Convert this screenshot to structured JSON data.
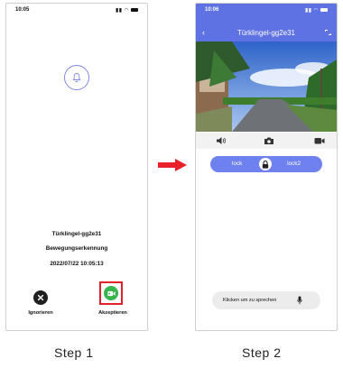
{
  "step1": {
    "status_time": "10:05",
    "device_name": "Türklingel-gg2e31",
    "event_type": "Bewegungserkennung",
    "timestamp": "2022/07/22 10:05:13",
    "decline_label": "Ignorieren",
    "accept_label": "Akzeptieren",
    "caption": "Step 1"
  },
  "step2": {
    "status_time": "10:06",
    "title": "Türklingel-gg2e31",
    "lock1_label": "lock",
    "lock2_label": "lock2",
    "speak_label": "Klicken um zu sprechen",
    "caption": "Step 2"
  },
  "colors": {
    "accent": "#5e72e4",
    "accept_green": "#37b44b",
    "highlight_red": "#e2222b",
    "arrow_red": "#e8212a"
  },
  "icons": {
    "bell": "bell-icon",
    "decline": "close-icon",
    "accept": "video-camera-icon",
    "speaker": "speaker-icon",
    "snapshot": "camera-icon",
    "record": "video-record-icon",
    "lock": "lock-icon",
    "mic": "microphone-icon"
  }
}
